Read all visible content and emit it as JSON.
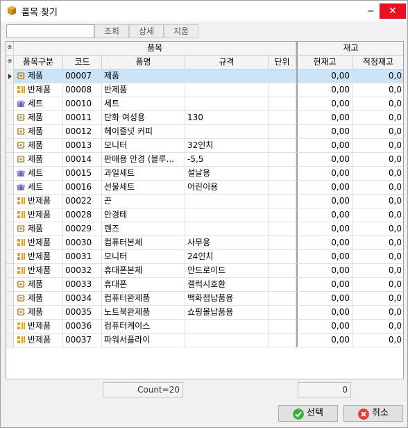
{
  "window": {
    "title": "품목 찾기",
    "minimize_label": "─",
    "close_label": "✕"
  },
  "toolbar": {
    "search_value": "",
    "lookup_label": "조회",
    "detail_label": "상세",
    "clear_label": "지움"
  },
  "grid": {
    "group_headers": {
      "item": "품목",
      "stock": "재고",
      "corner": "⁜"
    },
    "columns": [
      "품목구분",
      "코드",
      "품명",
      "규격",
      "단위",
      "현재고",
      "적정재고"
    ],
    "rows": [
      {
        "type": "제품",
        "icon": "product-icon",
        "code": "00007",
        "name": "제품",
        "spec": "",
        "unit": "",
        "current": "0,00",
        "optimal": "0,0",
        "selected": true
      },
      {
        "type": "반제품",
        "icon": "semi-product-icon",
        "code": "00008",
        "name": "반제품",
        "spec": "",
        "unit": "",
        "current": "0,00",
        "optimal": "0,0"
      },
      {
        "type": "세트",
        "icon": "set-icon",
        "code": "00010",
        "name": "세트",
        "spec": "",
        "unit": "",
        "current": "0,00",
        "optimal": "0,0"
      },
      {
        "type": "제품",
        "icon": "product-icon",
        "code": "00011",
        "name": "단화 여성용",
        "spec": "130",
        "unit": "",
        "current": "0,00",
        "optimal": "0,0"
      },
      {
        "type": "제품",
        "icon": "product-icon",
        "code": "00012",
        "name": "헤이즐넛 커피",
        "spec": "",
        "unit": "",
        "current": "0,00",
        "optimal": "0,0"
      },
      {
        "type": "제품",
        "icon": "product-icon",
        "code": "00013",
        "name": "모니터",
        "spec": "32인치",
        "unit": "",
        "current": "0,00",
        "optimal": "0,0"
      },
      {
        "type": "제품",
        "icon": "product-icon",
        "code": "00014",
        "name": "판매용 안경 (블루...",
        "spec": "-5,5",
        "unit": "",
        "current": "0,00",
        "optimal": "0,0"
      },
      {
        "type": "세트",
        "icon": "set-icon",
        "code": "00015",
        "name": "과일세트",
        "spec": "설날용",
        "unit": "",
        "current": "0,00",
        "optimal": "0,0"
      },
      {
        "type": "세트",
        "icon": "set-icon",
        "code": "00016",
        "name": "선물세트",
        "spec": "어린이용",
        "unit": "",
        "current": "0,00",
        "optimal": "0,0"
      },
      {
        "type": "반제품",
        "icon": "semi-product-icon",
        "code": "00022",
        "name": "끈",
        "spec": "",
        "unit": "",
        "current": "0,00",
        "optimal": "0,0"
      },
      {
        "type": "반제품",
        "icon": "semi-product-icon",
        "code": "00028",
        "name": "안경테",
        "spec": "",
        "unit": "",
        "current": "0,00",
        "optimal": "0,0"
      },
      {
        "type": "제품",
        "icon": "product-icon",
        "code": "00029",
        "name": "렌즈",
        "spec": "",
        "unit": "",
        "current": "0,00",
        "optimal": "0,0"
      },
      {
        "type": "반제품",
        "icon": "semi-product-icon",
        "code": "00030",
        "name": "컴퓨터본체",
        "spec": "사무용",
        "unit": "",
        "current": "0,00",
        "optimal": "0,0"
      },
      {
        "type": "반제품",
        "icon": "semi-product-icon",
        "code": "00031",
        "name": "모니터",
        "spec": "24인치",
        "unit": "",
        "current": "0,00",
        "optimal": "0,0"
      },
      {
        "type": "반제품",
        "icon": "semi-product-icon",
        "code": "00032",
        "name": "휴대폰본체",
        "spec": "안드로이드",
        "unit": "",
        "current": "0,00",
        "optimal": "0,0"
      },
      {
        "type": "제품",
        "icon": "product-icon",
        "code": "00033",
        "name": "휴대폰",
        "spec": "갤럭시호환",
        "unit": "",
        "current": "0,00",
        "optimal": "0,0"
      },
      {
        "type": "제품",
        "icon": "product-icon",
        "code": "00034",
        "name": "컴퓨터완제품",
        "spec": "백화점납품용",
        "unit": "",
        "current": "0,00",
        "optimal": "0,0"
      },
      {
        "type": "제품",
        "icon": "product-icon",
        "code": "00035",
        "name": "노트북완제품",
        "spec": "쇼핑몰납품용",
        "unit": "",
        "current": "0,00",
        "optimal": "0,0"
      },
      {
        "type": "반제품",
        "icon": "semi-product-icon",
        "code": "00036",
        "name": "컴퓨터케이스",
        "spec": "",
        "unit": "",
        "current": "0,00",
        "optimal": "0,0"
      },
      {
        "type": "반제품",
        "icon": "semi-product-icon",
        "code": "00037",
        "name": "파워서플라이",
        "spec": "",
        "unit": "",
        "current": "0,00",
        "optimal": "0,0"
      }
    ]
  },
  "footer": {
    "count_text": "Count=20",
    "stock_total": "0"
  },
  "buttons": {
    "select_label": "선택",
    "cancel_label": "취소"
  },
  "colors": {
    "product": "#c8a050",
    "semi_product": "#e8a020",
    "set": "#8070c0",
    "select_green": "#3cb043",
    "cancel_red": "#e04030"
  }
}
